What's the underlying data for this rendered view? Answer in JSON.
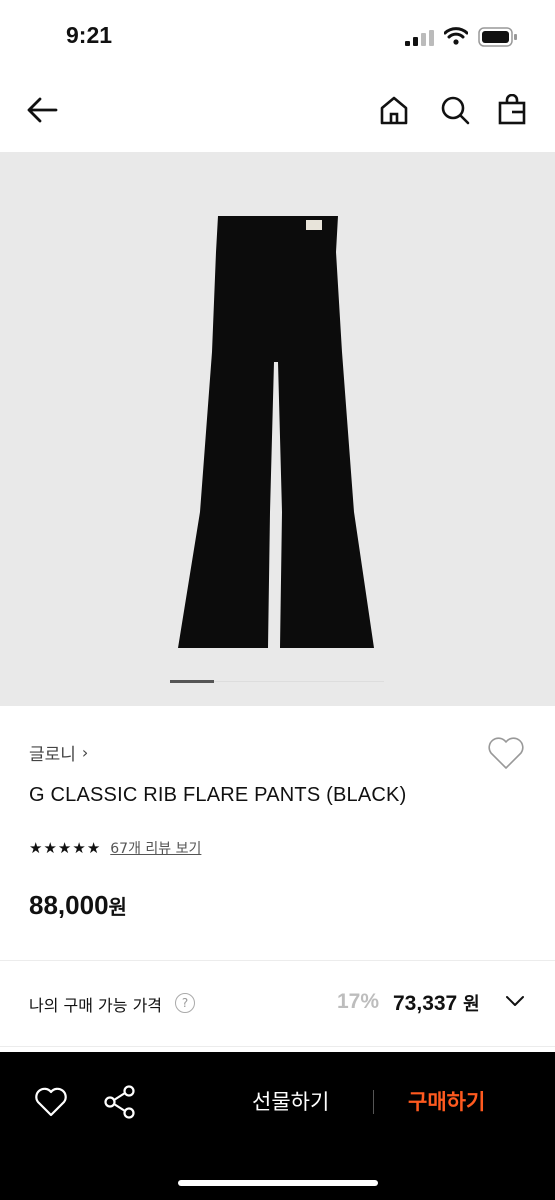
{
  "status_bar": {
    "time": "9:21"
  },
  "nav": {
    "back_icon": "arrow-left-icon",
    "home_icon": "home-icon",
    "search_icon": "search-icon",
    "bag_icon": "shopping-bag-icon"
  },
  "hero": {
    "image_alt": "G CLASSIC RIB FLARE PANTS (BLACK)",
    "slide_index": 1
  },
  "product": {
    "brand": "글로니",
    "brand_chevron": "›",
    "title": "G CLASSIC RIB FLARE PANTS (BLACK)",
    "rating_stars": 5,
    "review_link": "67개 리뷰 보기",
    "price_number": "88,000",
    "price_unit": "원"
  },
  "my_price": {
    "label": "나의 구매 가능 가격",
    "help": "?",
    "discount": "17%",
    "price_number": "73,337",
    "price_unit": "원"
  },
  "bottom_bar": {
    "gift_label": "선물하기",
    "buy_label": "구매하기",
    "buy_color": "#ff5a1f"
  }
}
